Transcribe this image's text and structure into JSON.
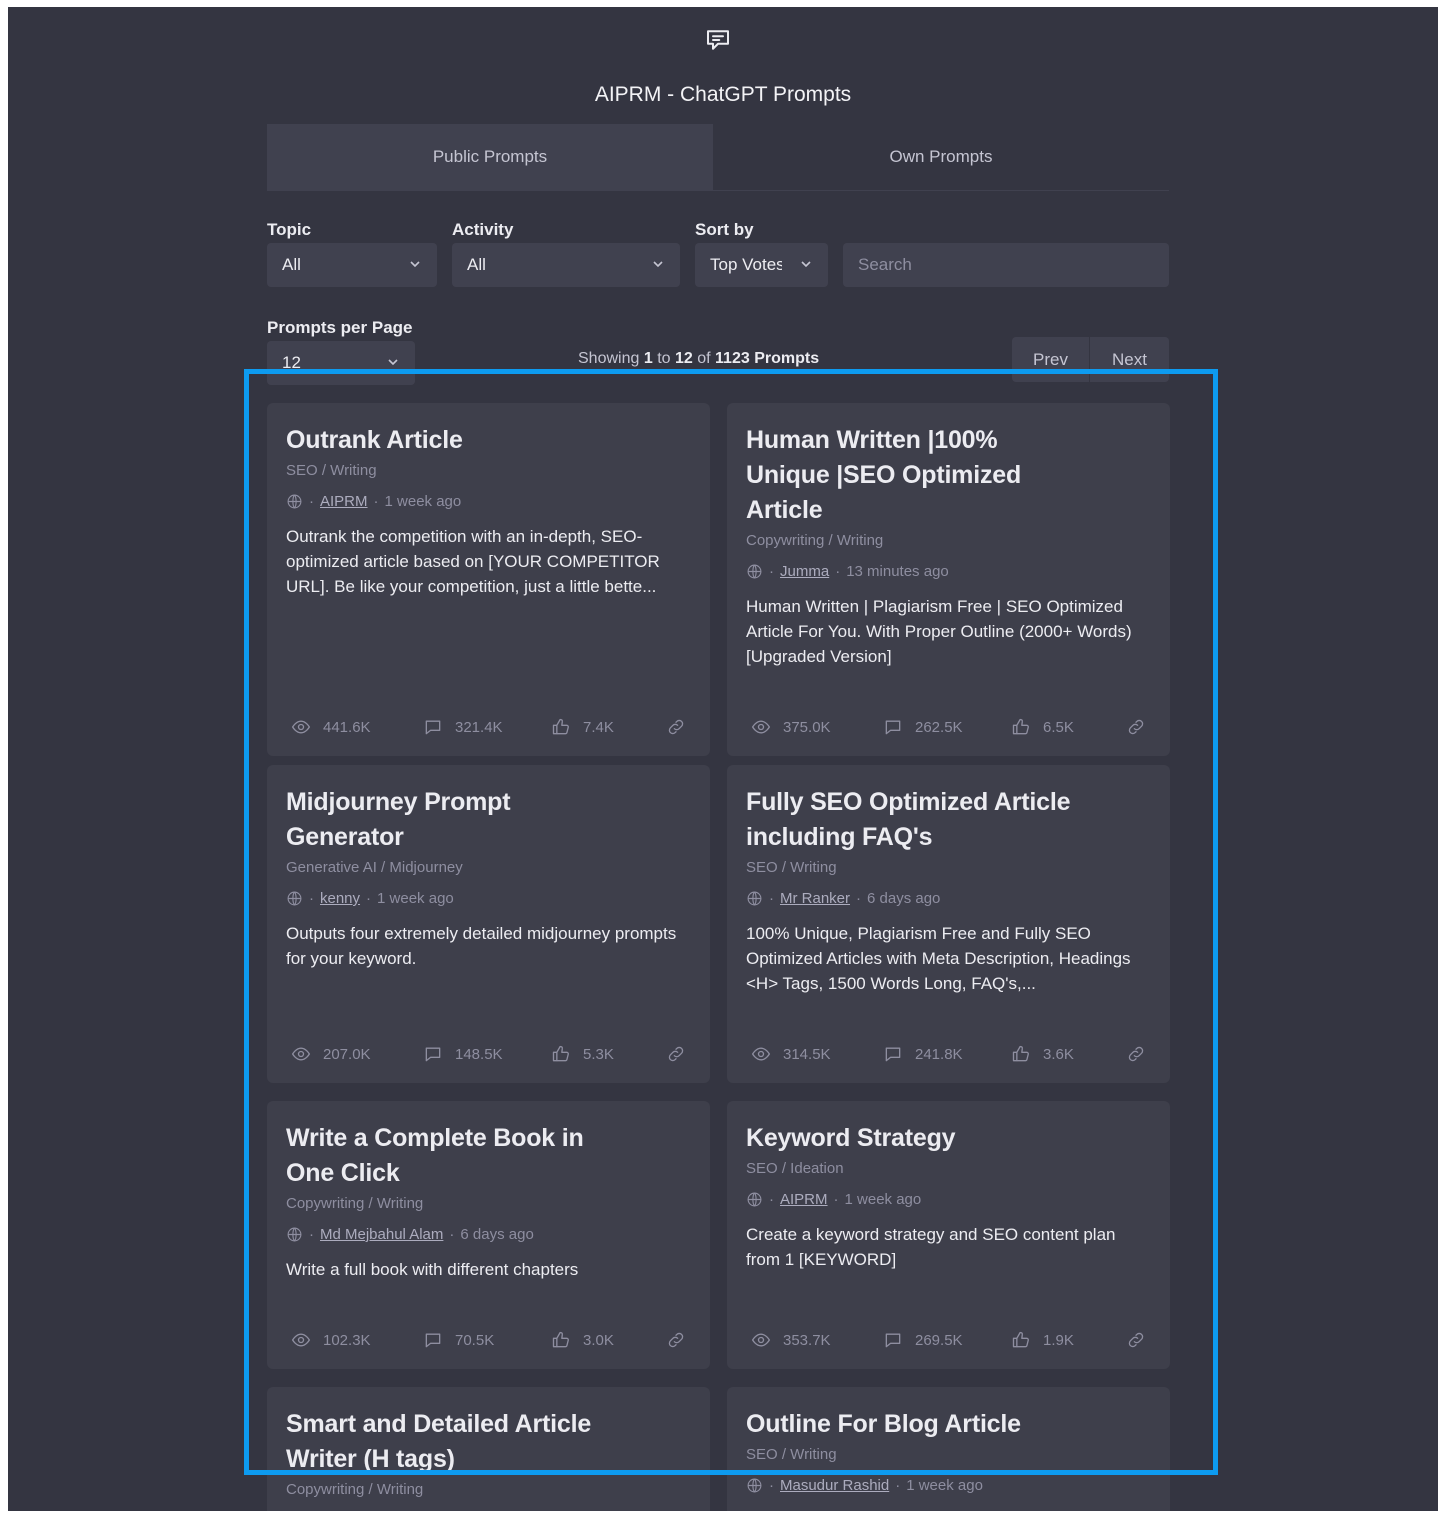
{
  "app": {
    "title": "AIPRM - ChatGPT Prompts",
    "icon": "chat-bubble-icon"
  },
  "tabs": [
    {
      "label": "Public Prompts",
      "active": true
    },
    {
      "label": "Own Prompts",
      "active": false
    }
  ],
  "filters": {
    "topic_label": "Topic",
    "topic_value": "All",
    "activity_label": "Activity",
    "activity_value": "All",
    "sort_label": "Sort by",
    "sort_value": "Top Votes",
    "search_placeholder": "Search",
    "per_page_label": "Prompts per Page",
    "per_page_value": "12"
  },
  "pagination": {
    "showing_prefix": "Showing",
    "from": "1",
    "to_word": "to",
    "to": "12",
    "of_word": "of",
    "total": "1123 Prompts",
    "prev_label": "Prev",
    "next_label": "Next"
  },
  "cards": [
    {
      "title": "Outrank Article",
      "category": "SEO / Writing",
      "author": "AIPRM",
      "time": "1 week ago",
      "description": "Outrank the competition with an in-depth, SEO-optimized article based on [YOUR COMPETITOR URL]. Be like your competition, just a little bette...",
      "views": "441.6K",
      "comments": "321.4K",
      "likes": "7.4K"
    },
    {
      "title": "Human Written |100% Unique |SEO Optimized Article",
      "category": "Copywriting / Writing",
      "author": "Jumma",
      "time": "13 minutes ago",
      "description": "Human Written | Plagiarism Free | SEO Optimized Article For You. With Proper Outline (2000+ Words) [Upgraded Version]",
      "views": "375.0K",
      "comments": "262.5K",
      "likes": "6.5K"
    },
    {
      "title": "Midjourney Prompt Generator",
      "category": "Generative AI / Midjourney",
      "author": "kenny",
      "time": "1 week ago",
      "description": "Outputs four extremely detailed midjourney prompts for your keyword.",
      "views": "207.0K",
      "comments": "148.5K",
      "likes": "5.3K"
    },
    {
      "title": "Fully SEO Optimized Article including FAQ's",
      "category": "SEO / Writing",
      "author": "Mr Ranker",
      "time": "6 days ago",
      "description": "100% Unique, Plagiarism Free and Fully SEO Optimized Articles with Meta Description, Headings <H> Tags, 1500 Words Long, FAQ's,...",
      "views": "314.5K",
      "comments": "241.8K",
      "likes": "3.6K"
    },
    {
      "title": "Write a Complete Book in One Click",
      "category": "Copywriting / Writing",
      "author": "Md Mejbahul Alam",
      "time": "6 days ago",
      "description": "Write a full book with different chapters",
      "views": "102.3K",
      "comments": "70.5K",
      "likes": "3.0K"
    },
    {
      "title": "Keyword Strategy",
      "category": "SEO / Ideation",
      "author": "AIPRM",
      "time": "1 week ago",
      "description": "Create a keyword strategy and SEO content plan from 1 [KEYWORD]",
      "views": "353.7K",
      "comments": "269.5K",
      "likes": "1.9K"
    },
    {
      "title": "Smart and Detailed Article Writer (H tags)",
      "category": "Copywriting / Writing",
      "author": "",
      "time": "",
      "description": "",
      "views": "",
      "comments": "",
      "likes": ""
    },
    {
      "title": "Outline For Blog Article",
      "category": "SEO / Writing",
      "author": "Masudur Rashid",
      "time": "1 week ago",
      "description": "",
      "views": "",
      "comments": "",
      "likes": ""
    }
  ],
  "icons": {
    "views": "eye-icon",
    "comments": "comment-icon",
    "likes": "thumbs-up-icon",
    "link": "link-icon",
    "visibility": "globe-icon"
  },
  "colors": {
    "background": "#343541",
    "card": "#3e3f4b",
    "control": "#40414f",
    "highlight_border": "#0d9bf0"
  }
}
